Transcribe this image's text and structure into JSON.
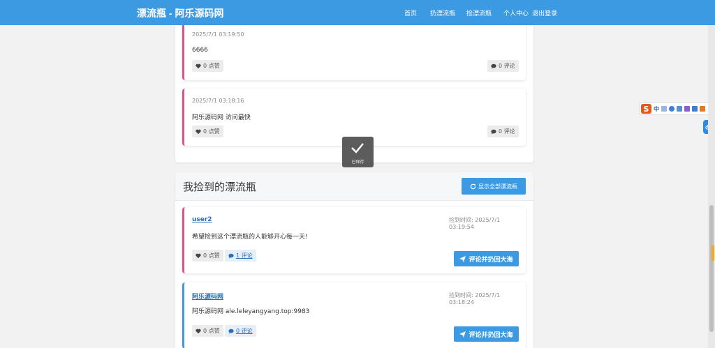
{
  "nav": {
    "brand": "漂流瓶 - 阿乐源码网",
    "links": [
      "首页",
      "扔漂流瓶",
      "捡漂流瓶",
      "个人中心",
      "退出登录"
    ]
  },
  "my_bottles": [
    {
      "time": "2025/7/1 03:19:50",
      "content": "6666",
      "likes": "0 点赞",
      "comments": "0 评论"
    },
    {
      "time": "2025/7/1 03:18:16",
      "content": "阿乐源码网 访问最快",
      "likes": "0 点赞",
      "comments": "0 评论"
    }
  ],
  "toast": {
    "label": "已保存"
  },
  "picked": {
    "title": "我捡到的漂流瓶",
    "show_all": "显示全部漂流瓶",
    "items": [
      {
        "user": "user2",
        "picked_time": "捡到时间: 2025/7/1 03:19:54",
        "content": "希望捡到这个漂流瓶的人能够开心每一天!",
        "likes": "0 点赞",
        "comments": "1 评论",
        "reply": "评论并扔回大海"
      },
      {
        "user": "阿乐源码网",
        "picked_time": "捡到时间: 2025/7/1 03:18:24",
        "content": "阿乐源码网 ale.leleyangyang.top:9983",
        "likes": "0 点赞",
        "comments": "0 评论",
        "reply": "评论并扔回大海"
      }
    ]
  },
  "ime": {
    "lang": "中"
  },
  "colors": {
    "primary": "#3b9ae1",
    "pink_border": "#e0508a",
    "blue_border": "#3b9ae1"
  },
  "icons": [
    "heart-icon",
    "comment-icon",
    "refresh-icon",
    "paper-plane-icon",
    "checkmark-icon",
    "sogou-ime-icon",
    "cloud-icon"
  ]
}
